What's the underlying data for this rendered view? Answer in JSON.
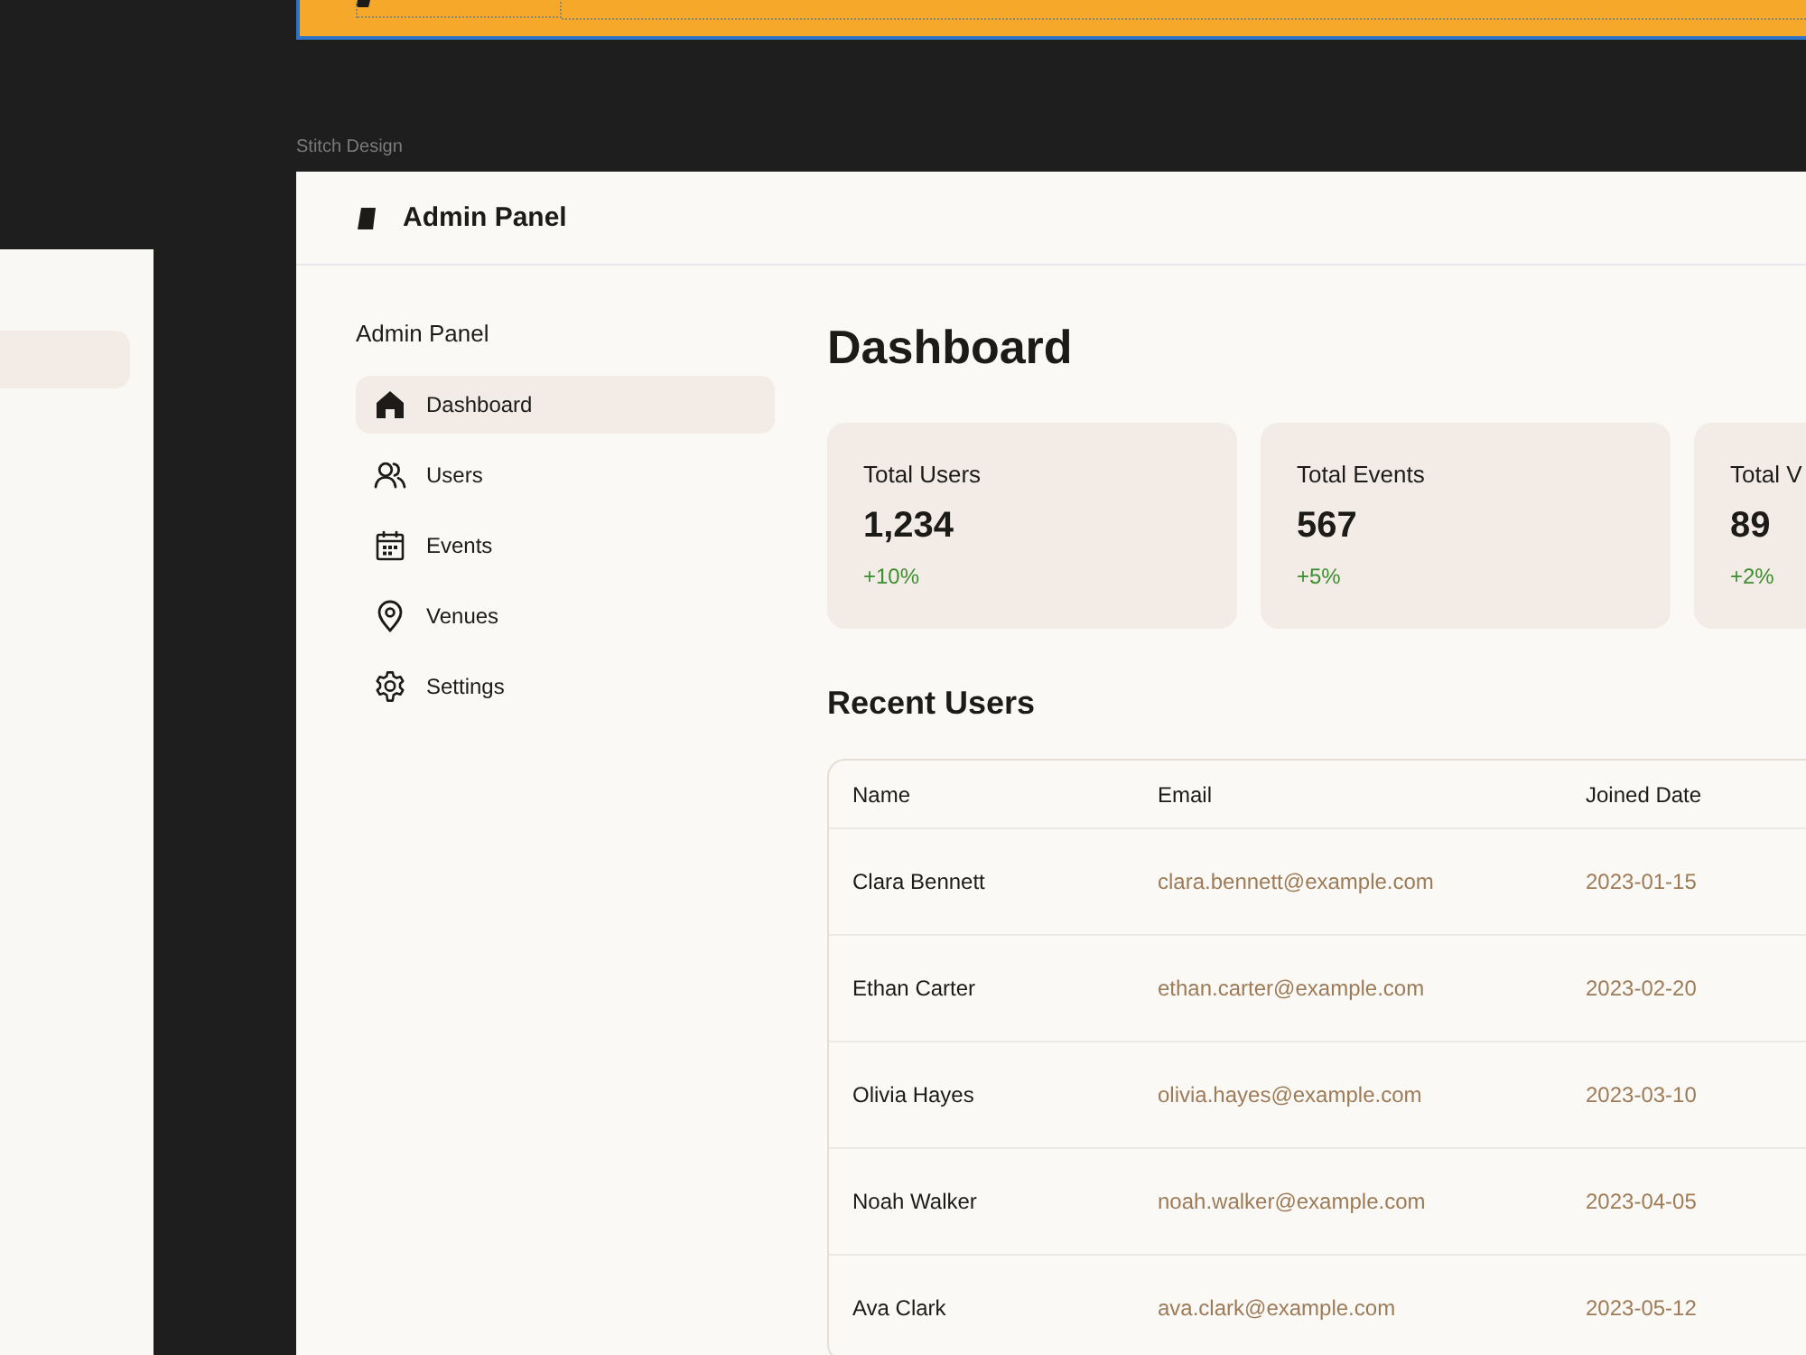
{
  "canvas": {
    "frame_label": "Stitch Design"
  },
  "header": {
    "title": "Admin Panel"
  },
  "sidebar": {
    "title": "Admin Panel",
    "items": [
      {
        "label": "Dashboard",
        "selected": true
      },
      {
        "label": "Users",
        "selected": false
      },
      {
        "label": "Events",
        "selected": false
      },
      {
        "label": "Venues",
        "selected": false
      },
      {
        "label": "Settings",
        "selected": false
      }
    ]
  },
  "main": {
    "title": "Dashboard",
    "stats": [
      {
        "label": "Total Users",
        "value": "1,234",
        "change": "+10%"
      },
      {
        "label": "Total Events",
        "value": "567",
        "change": "+5%"
      },
      {
        "label": "Total V",
        "value": "89",
        "change": "+2%"
      }
    ],
    "recent_users": {
      "title": "Recent Users",
      "columns": [
        "Name",
        "Email",
        "Joined Date"
      ],
      "rows": [
        {
          "name": "Clara Bennett",
          "email": "clara.bennett@example.com",
          "joined_date": "2023-01-15"
        },
        {
          "name": "Ethan Carter",
          "email": "ethan.carter@example.com",
          "joined_date": "2023-02-20"
        },
        {
          "name": "Olivia Hayes",
          "email": "olivia.hayes@example.com",
          "joined_date": "2023-03-10"
        },
        {
          "name": "Noah Walker",
          "email": "noah.walker@example.com",
          "joined_date": "2023-04-05"
        },
        {
          "name": "Ava Clark",
          "email": "ava.clark@example.com",
          "joined_date": "2023-05-12"
        }
      ]
    }
  }
}
